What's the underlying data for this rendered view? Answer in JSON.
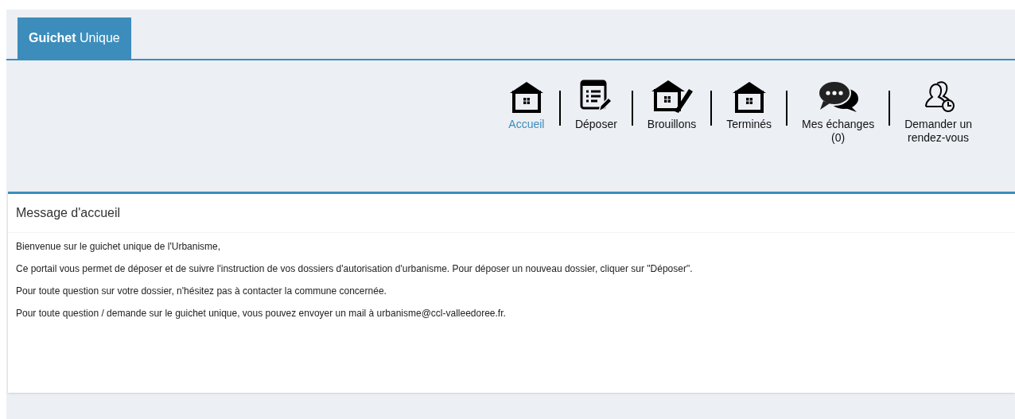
{
  "tabs": [
    {
      "label": "**Guichet** Unique",
      "selected": true
    }
  ],
  "nav": [
    {
      "kind": "house",
      "lines": [
        "Accueil"
      ],
      "selected": true
    },
    {
      "kind": "form",
      "lines": [
        "Déposer"
      ],
      "selected": false
    },
    {
      "kind": "house-pen",
      "lines": [
        "Brouillons"
      ],
      "selected": false
    },
    {
      "kind": "house",
      "lines": [
        "Terminés"
      ],
      "selected": false
    },
    {
      "kind": "chat",
      "lines": [
        "Mes échanges",
        "(0)"
      ],
      "selected": false
    },
    {
      "kind": "users-clock",
      "lines": [
        "Demander un",
        "rendez-vous"
      ],
      "selected": false
    }
  ],
  "panel": {
    "title": "Message d'accueil",
    "paragraphs": [
      "Bienvenue sur le guichet unique de l'Urbanisme,",
      "Ce portail vous permet de déposer et de suivre l'instruction de vos dossiers d'autorisation d'urbanisme. Pour déposer un nouveau dossier, cliquer sur \"Déposer\".",
      "Pour toute question sur votre dossier, n'hésitez pas à contacter la commune concernée.",
      "Pour toute question / demande sur le guichet unique, vous pouvez envoyer un mail à urbanisme@ccl-valleedoree.fr."
    ]
  }
}
